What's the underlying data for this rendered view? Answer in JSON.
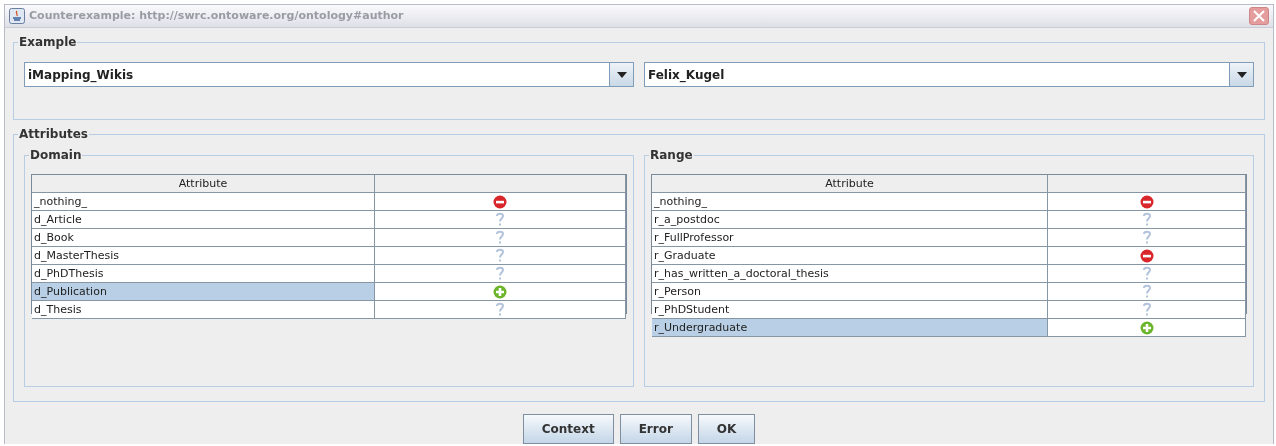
{
  "window": {
    "title": "Counterexample: http://swrc.ontoware.org/ontology#author"
  },
  "example": {
    "legend": "Example",
    "dropdowns": [
      {
        "value": "iMapping_Wikis"
      },
      {
        "value": "Felix_Kugel"
      }
    ]
  },
  "attributes": {
    "legend": "Attributes",
    "panels": [
      {
        "legend": "Domain",
        "columns": [
          "Attribute"
        ],
        "rows": [
          {
            "name": "_nothing_",
            "kind": "negative",
            "selected": false
          },
          {
            "name": "d_Article",
            "kind": "unknown",
            "selected": false
          },
          {
            "name": "d_Book",
            "kind": "unknown",
            "selected": false
          },
          {
            "name": "d_MasterThesis",
            "kind": "unknown",
            "selected": false
          },
          {
            "name": "d_PhDThesis",
            "kind": "unknown",
            "selected": false
          },
          {
            "name": "d_Publication",
            "kind": "positive",
            "selected": true
          },
          {
            "name": "d_Thesis",
            "kind": "unknown",
            "selected": false
          }
        ]
      },
      {
        "legend": "Range",
        "columns": [
          "Attribute"
        ],
        "rows": [
          {
            "name": "_nothing_",
            "kind": "negative",
            "selected": false
          },
          {
            "name": "r_a_postdoc",
            "kind": "unknown",
            "selected": false
          },
          {
            "name": "r_FullProfessor",
            "kind": "unknown",
            "selected": false
          },
          {
            "name": "r_Graduate",
            "kind": "negative",
            "selected": false
          },
          {
            "name": "r_has_written_a_doctoral_thesis",
            "kind": "unknown",
            "selected": false
          },
          {
            "name": "r_Person",
            "kind": "unknown",
            "selected": false
          },
          {
            "name": "r_PhDStudent",
            "kind": "unknown",
            "selected": false
          },
          {
            "name": "r_Undergraduate",
            "kind": "positive",
            "selected": true
          }
        ]
      }
    ]
  },
  "buttons": [
    "Context",
    "Error",
    "OK"
  ]
}
